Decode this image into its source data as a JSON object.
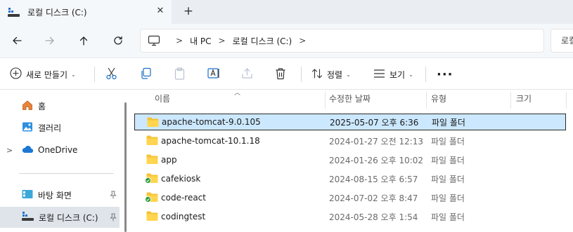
{
  "window": {
    "tab_title": "로컬 디스크 (C:)",
    "tab_close_icon": "close-icon",
    "new_tab_icon": "plus-icon"
  },
  "navigation": {
    "back_icon": "arrow-left-icon",
    "forward_icon": "arrow-right-icon",
    "up_icon": "arrow-up-icon",
    "refresh_icon": "refresh-icon",
    "breadcrumb": [
      "내 PC",
      "로컬 디스크 (C:)"
    ],
    "search_placeholder": "로컬 디스크 (C:) 검색"
  },
  "commandbar": {
    "new_label": "새로 만들기",
    "sort_label": "정렬",
    "view_label": "보기",
    "more_icon": "more-horizontal-icon"
  },
  "sidebar": {
    "home": "홈",
    "gallery": "갤러리",
    "onedrive": "OneDrive",
    "desktop": "바탕 화면",
    "local_disk": "로컬 디스크 (C:)"
  },
  "columns": {
    "name": "이름",
    "modified": "수정한 날짜",
    "type": "유형",
    "size": "크기"
  },
  "files": [
    {
      "name": "apache-tomcat-9.0.105",
      "modified": "2025-05-07 오후 6:36",
      "type": "파일 폴더",
      "synced": false,
      "selected": true
    },
    {
      "name": "apache-tomcat-10.1.18",
      "modified": "2024-01-27 오전 12:13",
      "type": "파일 폴더",
      "synced": false,
      "selected": false
    },
    {
      "name": "app",
      "modified": "2024-01-26 오후 10:02",
      "type": "파일 폴더",
      "synced": false,
      "selected": false
    },
    {
      "name": "cafekiosk",
      "modified": "2024-08-15 오후 6:57",
      "type": "파일 폴더",
      "synced": true,
      "selected": false
    },
    {
      "name": "code-react",
      "modified": "2024-07-02 오후 8:47",
      "type": "파일 폴더",
      "synced": true,
      "selected": false
    },
    {
      "name": "codingtest",
      "modified": "2024-05-28 오후 1:54",
      "type": "파일 폴더",
      "synced": false,
      "selected": false
    }
  ],
  "colors": {
    "selection_bg": "#cce8ff",
    "folder_yellow": "#f4c236",
    "sync_green": "#2a9a3a",
    "accent_blue": "#1d6fc7"
  }
}
